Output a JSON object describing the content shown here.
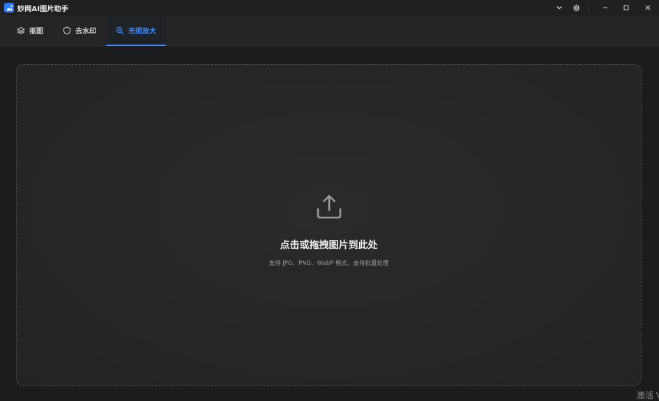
{
  "app": {
    "title": "妙网AI图片助手",
    "accent": "#3d8bff",
    "logo_color": "#2f7bf6"
  },
  "title_controls": {
    "dropdown_icon": "chevron-down-icon",
    "settings_icon": "gear-icon",
    "minimize_icon": "minimize-icon",
    "maximize_icon": "maximize-icon",
    "close_icon": "close-icon"
  },
  "tabs": [
    {
      "label": "抠图",
      "icon": "layers-icon",
      "active": false
    },
    {
      "label": "去水印",
      "icon": "shield-icon",
      "active": false
    },
    {
      "label": "无损放大",
      "icon": "zoom-in-icon",
      "active": true
    }
  ],
  "dropzone": {
    "icon": "upload-icon",
    "title": "点击或拖拽图片到此处",
    "subtitle": "支持 JPG、PNG、WebP 格式，支持批量处理"
  },
  "os_overlay": {
    "text": "激活 V"
  }
}
